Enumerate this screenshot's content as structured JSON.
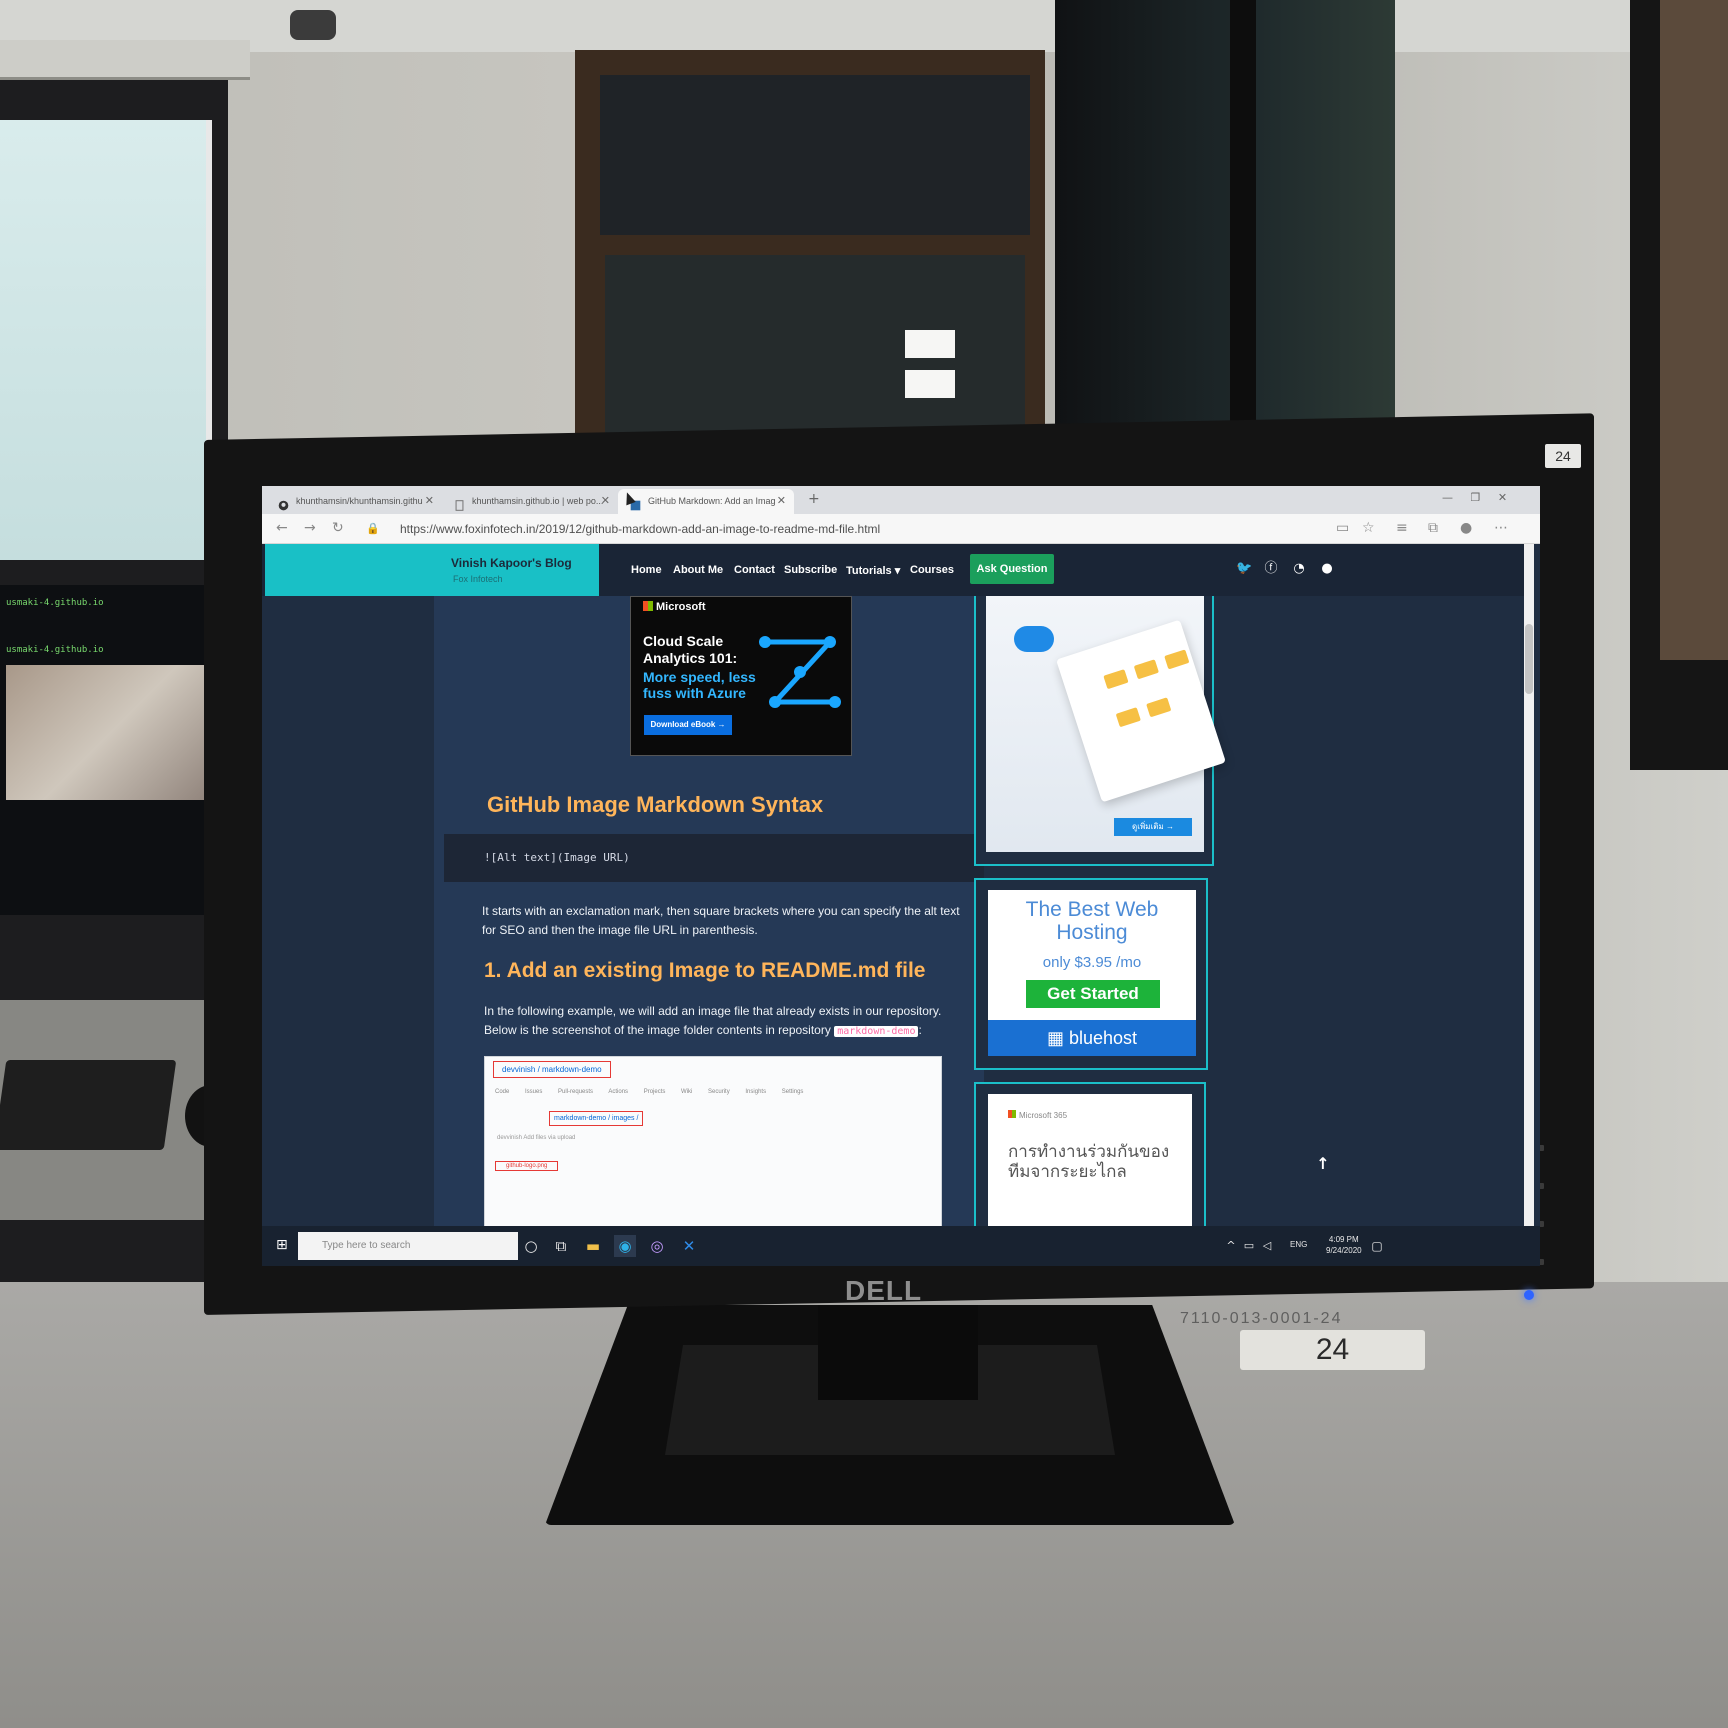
{
  "browser": {
    "tabs": [
      {
        "title": "khunthamsin/khunthamsin.githu"
      },
      {
        "title": "khunthamsin.github.io | web po..."
      },
      {
        "title": "GitHub Markdown: Add an Imag"
      }
    ],
    "new_tab_symbol": "+",
    "url": "https://www.foxinfotech.in/2019/12/github-markdown-add-an-image-to-readme-md-file.html"
  },
  "site": {
    "brand_title": "Vinish Kapoor's Blog",
    "brand_subtitle": "Fox Infotech",
    "menu": [
      "Home",
      "About Me",
      "Contact",
      "Subscribe",
      "Tutorials ▾",
      "Courses"
    ],
    "ask_button": "Ask Question"
  },
  "ad_microsoft": {
    "brand": "Microsoft",
    "title": "Cloud Scale Analytics 101:",
    "subtitle": "More speed, less fuss with Azure",
    "button": "Download eBook →"
  },
  "article": {
    "heading": "GitHub Image Markdown Syntax",
    "code": "![Alt text](Image URL)",
    "paragraph1": "It starts with an exclamation mark, then square brackets where you can specify the alt text for SEO and then the image file URL in parenthesis.",
    "heading2": "1. Add an existing Image to README.md file",
    "paragraph2": "In the following example, we will add an image file that already exists in our repository. Below is the screenshot of the image folder contents in repository",
    "repo_code": "markdown-demo",
    "screenshot": {
      "repo": "devvinish / markdown-demo",
      "tabs": "Code Issues Pull-requests Actions Projects Wiki Security Insights Settings",
      "path": "markdown-demo / images /",
      "row": "devvinish Add files via upload",
      "file": "github-logo.png"
    }
  },
  "sidebar": {
    "ad1_button": "ดูเพิ่มเติม →",
    "bluehost": {
      "title": "The Best Web Hosting",
      "price": "only  $3.95 /mo",
      "button": "Get Started",
      "brand": "bluehost"
    },
    "ms365": {
      "label": "Microsoft 365",
      "thai": "การทำงานร่วมกันของทีมจากระยะไกล"
    }
  },
  "taskbar": {
    "search_placeholder": "Type here to search",
    "lang": "ENG",
    "time": "4:09 PM",
    "date": "9/24/2020"
  },
  "room": {
    "monitor_brand": "DELL",
    "monitor_label": "24",
    "desk_sticker": "24",
    "desk_asset_tag": "7110-013-0001-24",
    "left_terminal_lines": [
      "usmaki-4.github.io",
      "usmaki-4.github.io"
    ]
  },
  "colors": {
    "brand_teal": "#19c0c6",
    "heading_orange": "#ffb55a",
    "ask_green": "#1b9f5c",
    "bluehost_blue": "#1a70d2"
  }
}
